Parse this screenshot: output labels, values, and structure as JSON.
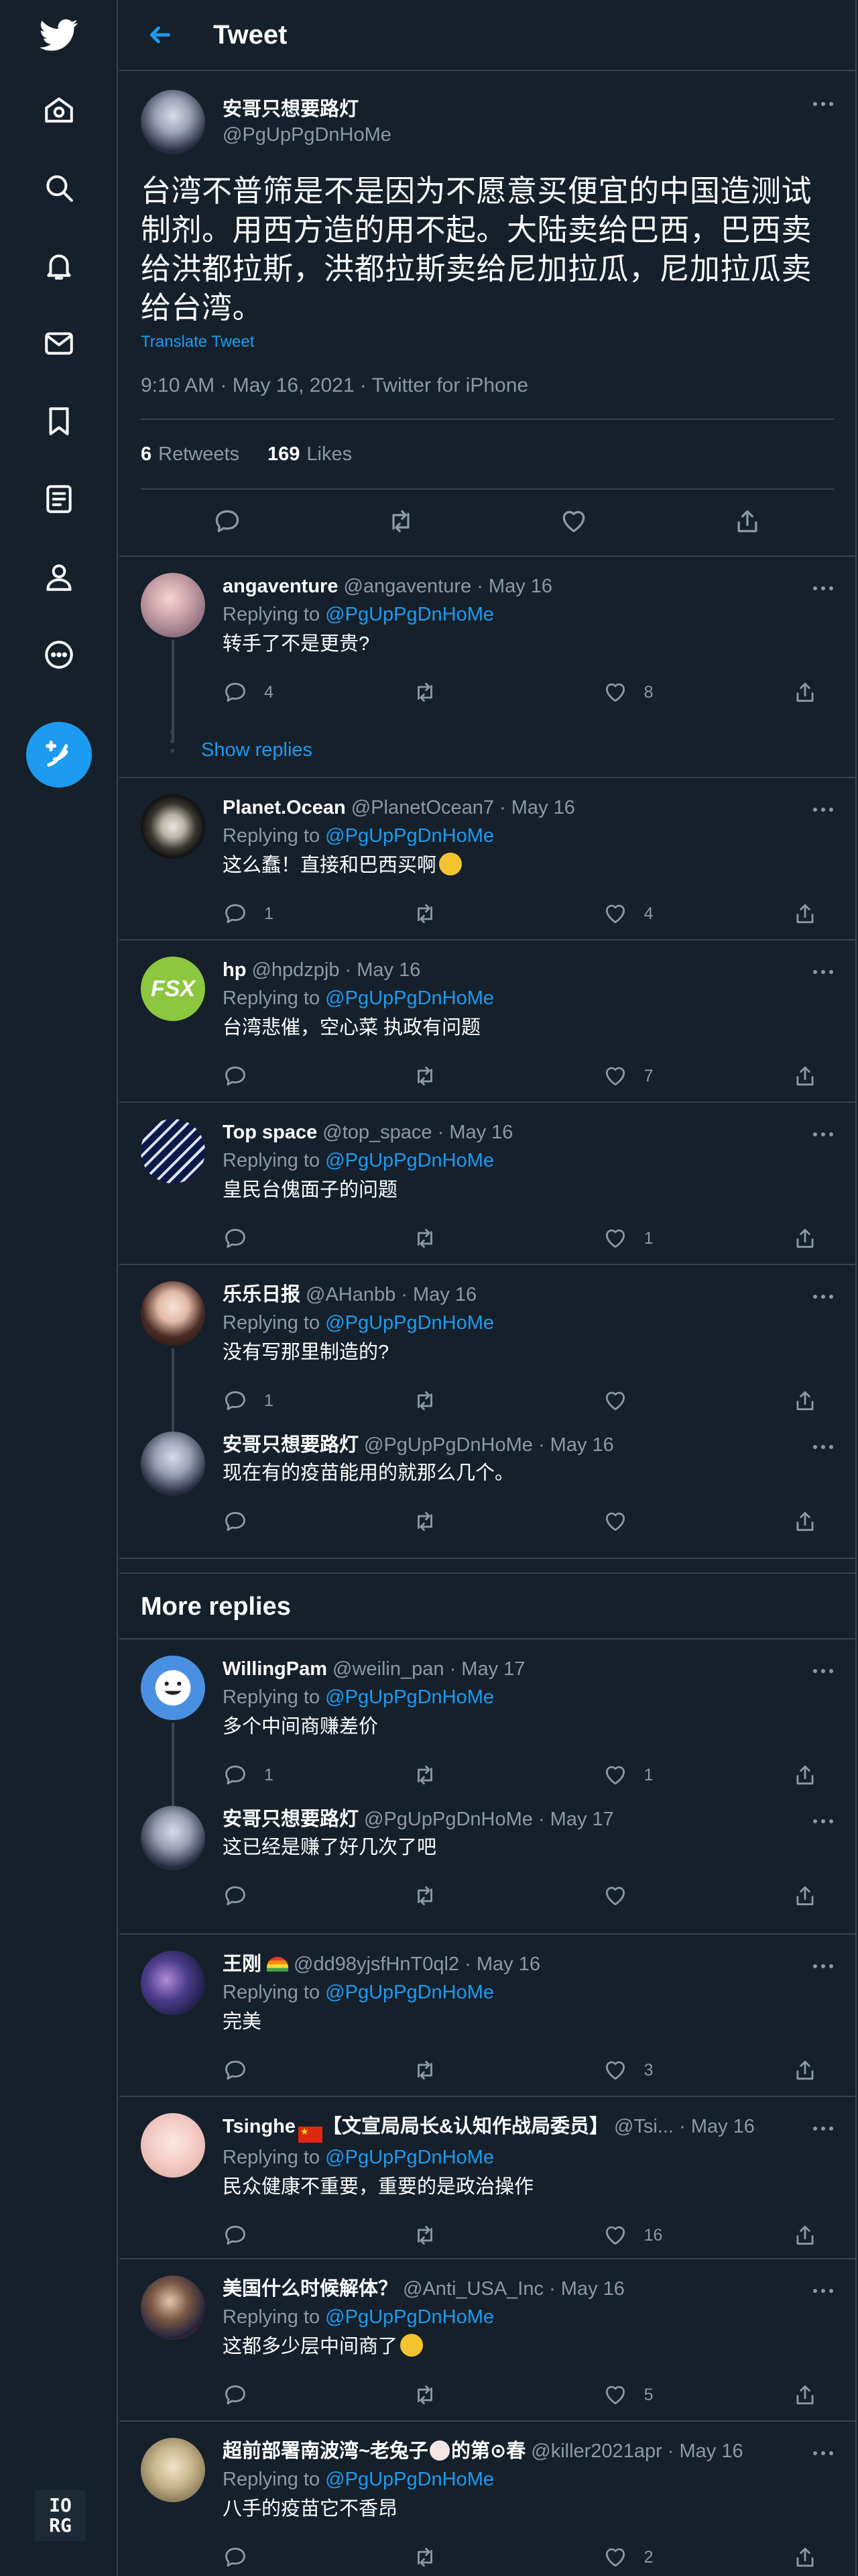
{
  "header": {
    "title": "Tweet"
  },
  "main_tweet": {
    "name": "安哥只想要路灯",
    "handle": "@PgUpPgDnHoMe",
    "text": "台湾不普筛是不是因为不愿意买便宜的中国造测试制剂。用西方造的用不起。大陆卖给巴西，巴西卖给洪都拉斯，洪都拉斯卖给尼加拉瓜，尼加拉瓜卖给台湾。",
    "translate": "Translate Tweet",
    "meta": "9:10 AM · May 16, 2021 · Twitter for iPhone",
    "retweets_count": "6",
    "retweets_label": "Retweets",
    "likes_count": "169",
    "likes_label": "Likes"
  },
  "replies": [
    {
      "name": "angaventure",
      "handle": "@angaventure",
      "time": "· May 16",
      "replying_prefix": "Replying to",
      "replying_to": "@PgUpPgDnHoMe",
      "text": "转手了不是更贵?",
      "reply_count": "4",
      "retweet_count": "",
      "like_count": "8"
    },
    {
      "show_replies": "Show replies"
    },
    {
      "name": "Planet.Ocean",
      "handle": "@PlanetOcean7",
      "time": "· May 16",
      "replying_prefix": "Replying to",
      "replying_to": "@PgUpPgDnHoMe",
      "text": "这么蠢！直接和巴西买啊",
      "reply_count": "1",
      "retweet_count": "",
      "like_count": "4"
    },
    {
      "name": "hp",
      "handle": "@hpdzpjb",
      "time": "· May 16",
      "replying_prefix": "Replying to",
      "replying_to": "@PgUpPgDnHoMe",
      "text": "台湾悲催，空心菜 执政有问题",
      "reply_count": "",
      "retweet_count": "",
      "like_count": "7"
    },
    {
      "name": "Top space",
      "handle": "@top_space",
      "time": "· May 16",
      "replying_prefix": "Replying to",
      "replying_to": "@PgUpPgDnHoMe",
      "text": "皇民台傀面子的问题",
      "reply_count": "",
      "retweet_count": "",
      "like_count": "1"
    },
    {
      "name": "乐乐日报",
      "handle": "@AHanbb",
      "time": "· May 16",
      "replying_prefix": "Replying to",
      "replying_to": "@PgUpPgDnHoMe",
      "text": "没有写那里制造的?",
      "reply_count": "1",
      "retweet_count": "",
      "like_count": ""
    },
    {
      "name": "安哥只想要路灯",
      "handle": "@PgUpPgDnHoMe",
      "time": "· May 16",
      "text": "现在有的疫苗能用的就那么几个。",
      "reply_count": "",
      "retweet_count": "",
      "like_count": ""
    }
  ],
  "more_replies_title": "More replies",
  "more_replies": [
    {
      "name": "WillingPam",
      "handle": "@weilin_pan",
      "time": "· May 17",
      "replying_prefix": "Replying to",
      "replying_to": "@PgUpPgDnHoMe",
      "text": "多个中间商赚差价",
      "reply_count": "1",
      "retweet_count": "",
      "like_count": "1"
    },
    {
      "name": "安哥只想要路灯",
      "handle": "@PgUpPgDnHoMe",
      "time": "· May 17",
      "text": "这已经是赚了好几次了吧",
      "reply_count": "",
      "retweet_count": "",
      "like_count": ""
    },
    {
      "name": "王刚",
      "handle": "@dd98yjsfHnT0ql2",
      "time": "· May 16",
      "replying_prefix": "Replying to",
      "replying_to": "@PgUpPgDnHoMe",
      "text": "完美",
      "reply_count": "",
      "retweet_count": "",
      "like_count": "3"
    },
    {
      "name": "Tsinghe",
      "name_suffix": "【文宣局局长&认知作战局委员】",
      "handle": "@Tsi...",
      "time": "· May 16",
      "replying_prefix": "Replying to",
      "replying_to": "@PgUpPgDnHoMe",
      "text": "民众健康不重要，重要的是政治操作",
      "reply_count": "",
      "retweet_count": "",
      "like_count": "16"
    },
    {
      "name": "美国什么时候解体？",
      "handle": "@Anti_USA_Inc",
      "time": "· May 16",
      "replying_prefix": "Replying to",
      "replying_to": "@PgUpPgDnHoMe",
      "text": "这都多少层中间商了",
      "reply_count": "",
      "retweet_count": "",
      "like_count": "5"
    },
    {
      "name": "超前部署南波湾~老兔子",
      "name_suffix": "的第⊙春",
      "handle": "@killer2021apr",
      "time": "· May 16",
      "replying_prefix": "Replying to",
      "replying_to": "@PgUpPgDnHoMe",
      "text": "八手的疫苗它不香昂",
      "reply_count": "",
      "retweet_count": "",
      "like_count": "2"
    }
  ],
  "badge": {
    "line1": "IO",
    "line2": "RG"
  },
  "colors": {
    "background": "#15202b",
    "accent": "#1d9bf0",
    "muted": "#8b98a5",
    "border": "#38444d"
  }
}
